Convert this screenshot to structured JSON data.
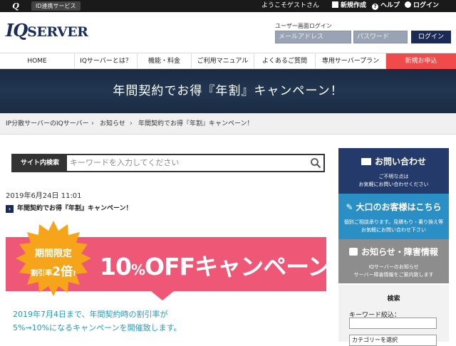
{
  "topbar": {
    "logo": "Q",
    "service_label": "ID連携サービス",
    "welcome": "ようこそゲストさん",
    "new_account": "新規作成",
    "help": "ヘルプ",
    "login": "ログイン"
  },
  "header": {
    "logo_iq": "IQ",
    "logo_server": "SERVER",
    "login_label": "ユーザー画面ログイン",
    "email_placeholder": "メールアドレス",
    "password_placeholder": "パスワード",
    "login_button": "ログイン"
  },
  "nav": {
    "items": [
      "HOME",
      "IQサーバーとは？",
      "機能・料金",
      "ご利用マニュアル",
      "よくあるご質問",
      "専用サーバープラン",
      "新規お申込"
    ]
  },
  "hero": {
    "title": "年間契約でお得『年割』キャンペーン！"
  },
  "breadcrumb": {
    "items": [
      "IP分散サーバーのIQサーバー",
      "お知らせ",
      "年間契約でお得『年割』キャンペーン！"
    ]
  },
  "search": {
    "label": "サイト内検索",
    "placeholder": "キーワードを入力してください"
  },
  "post": {
    "date": "2019年6月24日 11:01",
    "title": "年間契約でお得『年割』キャンペーン！"
  },
  "banner": {
    "badge_line1": "期間限定",
    "badge_line2a": "割引率",
    "badge_line2b": "2倍",
    "badge_line2c": "!",
    "off_num": "10",
    "off_pct": "%",
    "off_rest": "OFFキャンペーン!!",
    "colors": {
      "pink": "#ee5775",
      "orange": "#f6a51b"
    }
  },
  "description": {
    "line1": "2019年7月4日まで、年間契約時の割引率が",
    "line2": "5%→10%になるキャンペーンを開催致します。"
  },
  "sidebar": {
    "contact_title": "お問い合わせ",
    "contact_sub1": "ご不明な点は",
    "contact_sub2": "お気軽にお問い合わせください",
    "bulk_title": "大口のお客様はこちら",
    "bulk_sub1": "個別ご相談承ります。見積もり・乗り換え等",
    "bulk_sub2": "お気軽にお問い合わせ下さい",
    "news_title": "お知らせ・障害情報",
    "news_sub1": "IQサーバーのお知らせ",
    "news_sub2": "サーバー障害情報をご案内致します",
    "search_title": "検索",
    "keyword_label": "キーワード絞込：",
    "category_placeholder": "カテゴリーを選択"
  }
}
